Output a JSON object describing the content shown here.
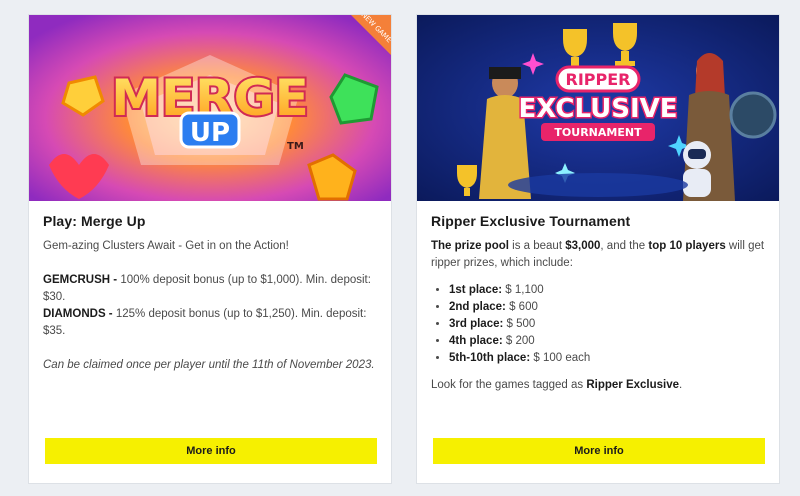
{
  "cards": [
    {
      "hero": {
        "logo_line1": "MERGE",
        "logo_line2": "UP",
        "tm": "TM",
        "ribbon": "NEW GAME"
      },
      "title": "Play: Merge Up",
      "subtitle": "Gem-azing Clusters Await - Get in on the Action!",
      "offers": [
        {
          "code": "GEMCRUSH -",
          "text": " 100% deposit bonus (up to $1,000). Min. deposit: $30."
        },
        {
          "code": "DIAMONDS -",
          "text": " 125% deposit bonus (up to $1,250). Min. deposit: $35."
        }
      ],
      "note": "Can be claimed once per player until the 11th of November 2023.",
      "button": "More info"
    },
    {
      "hero": {
        "line1": "RIPPER",
        "line2": "EXCLUSIVE",
        "line3": "TOURNAMENT"
      },
      "title": "Ripper Exclusive Tournament",
      "intro": {
        "a": "The prize pool",
        "b": " is a beaut ",
        "c": "$3,000",
        "d": ", and the ",
        "e": "top 10 players",
        "f": " will get ripper prizes, which include:"
      },
      "prizes": [
        {
          "place": "1st place:",
          "amount": " $ 1,100"
        },
        {
          "place": "2nd place:",
          "amount": " $ 600"
        },
        {
          "place": "3rd place:",
          "amount": " $ 500"
        },
        {
          "place": "4th place:",
          "amount": " $ 200"
        },
        {
          "place": "5th-10th place:",
          "amount": " $ 100 each"
        }
      ],
      "footer": {
        "a": "Look for the games tagged as ",
        "b": "Ripper Exclusive",
        "c": "."
      },
      "button": "More info"
    }
  ],
  "colors": {
    "button": "#f6f000",
    "page_bg": "#eceff3",
    "tournament_bg": "#10226b",
    "merge_bg": "#c43ac8"
  }
}
